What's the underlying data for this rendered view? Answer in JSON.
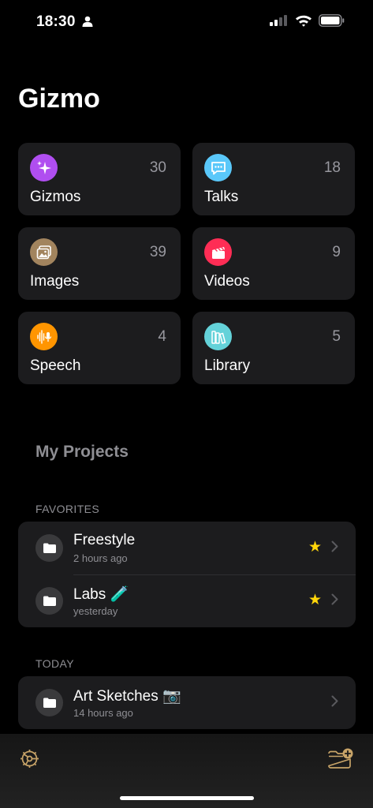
{
  "status": {
    "time": "18:30"
  },
  "app": {
    "title": "Gizmo"
  },
  "tiles": [
    {
      "label": "Gizmos",
      "count": "30",
      "icon": "sparkles-icon",
      "color": "#b04ef0"
    },
    {
      "label": "Talks",
      "count": "18",
      "icon": "chat-bubble-icon",
      "color": "#5ac8fa"
    },
    {
      "label": "Images",
      "count": "39",
      "icon": "photo-icon",
      "color": "#a2845e"
    },
    {
      "label": "Videos",
      "count": "9",
      "icon": "clapperboard-icon",
      "color": "#ff2d55"
    },
    {
      "label": "Speech",
      "count": "4",
      "icon": "waveform-mic-icon",
      "color": "#ff9500"
    },
    {
      "label": "Library",
      "count": "5",
      "icon": "books-icon",
      "color": "#64d2d9"
    }
  ],
  "projects": {
    "section_title": "My Projects",
    "groups": [
      {
        "header": "FAVORITES",
        "items": [
          {
            "title": "Freestyle",
            "subtitle": "2 hours ago",
            "favorite": true
          },
          {
            "title": "Labs 🧪",
            "subtitle": "yesterday",
            "favorite": true
          }
        ]
      },
      {
        "header": "TODAY",
        "items": [
          {
            "title": "Art Sketches 📷",
            "subtitle": "14 hours ago",
            "favorite": false
          }
        ]
      }
    ]
  },
  "tabbar": {
    "settings_icon": "gear-icon",
    "new_folder_icon": "folder-badge-plus-icon"
  },
  "star_glyph": "★"
}
